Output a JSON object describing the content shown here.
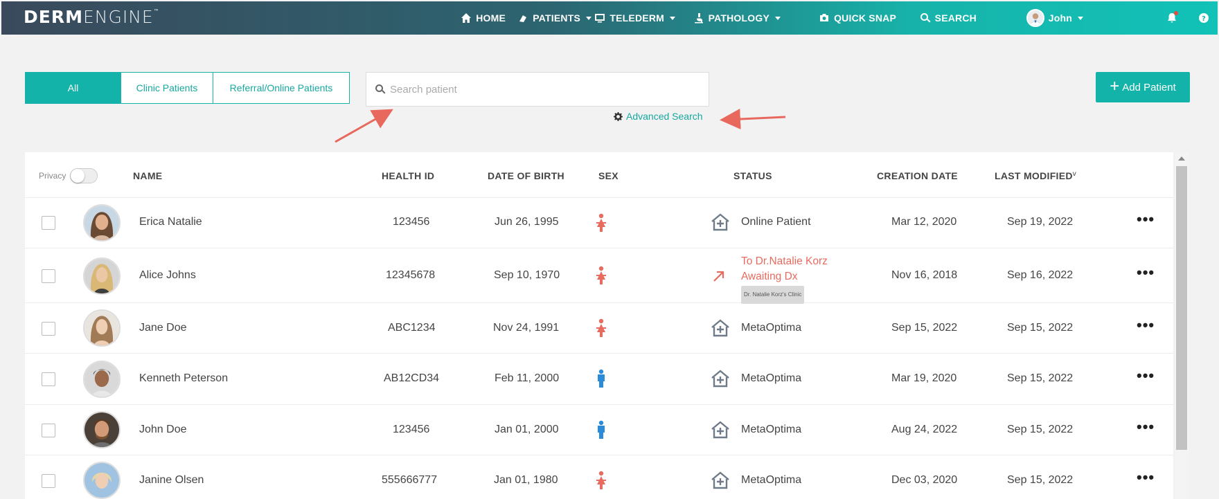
{
  "app": {
    "logo_bold": "DERM",
    "logo_light": "ENGINE",
    "logo_tm": "™"
  },
  "nav": {
    "home": "HOME",
    "patients": "PATIENTS",
    "telederm": "TELEDERM",
    "pathology": "PATHOLOGY",
    "quick_snap": "QUICK SNAP",
    "search": "SEARCH",
    "user": "John"
  },
  "filters": {
    "tabs": [
      {
        "label": "All",
        "active": true
      },
      {
        "label": "Clinic Patients",
        "active": false
      },
      {
        "label": "Referral/Online Patients",
        "active": false
      }
    ]
  },
  "search": {
    "placeholder": "Search patient",
    "advanced_label": "Advanced Search"
  },
  "actions": {
    "add_patient": "Add Patient"
  },
  "table": {
    "privacy_label": "Privacy",
    "columns": {
      "name": "NAME",
      "health_id": "HEALTH ID",
      "dob": "DATE OF BIRTH",
      "sex": "SEX",
      "status": "STATUS",
      "creation_date": "CREATION DATE",
      "last_modified": "LAST MODIFIED"
    },
    "rows": [
      {
        "name": "Erica Natalie",
        "health_id": "123456",
        "dob": "Jun 26, 1995",
        "sex": "female",
        "status": "Online Patient",
        "status_type": "clinic",
        "created": "Mar 12, 2020",
        "modified": "Sep 19, 2022"
      },
      {
        "name": "Alice Johns",
        "health_id": "12345678",
        "dob": "Sep 10, 1970",
        "sex": "female",
        "status_line1": "To Dr.Natalie Korz",
        "status_line2": "Awaiting Dx",
        "status_tag": "Dr. Natalie Korz's Clinic",
        "status_type": "referral",
        "created": "Nov 16, 2018",
        "modified": "Sep 16, 2022"
      },
      {
        "name": "Jane Doe",
        "health_id": "ABC1234",
        "dob": "Nov 24, 1991",
        "sex": "female",
        "status": "MetaOptima",
        "status_type": "clinic",
        "created": "Sep 15, 2022",
        "modified": "Sep 15, 2022"
      },
      {
        "name": "Kenneth Peterson",
        "health_id": "AB12CD34",
        "dob": "Feb 11, 2000",
        "sex": "male",
        "status": "MetaOptima",
        "status_type": "clinic",
        "created": "Mar 19, 2020",
        "modified": "Sep 15, 2022"
      },
      {
        "name": "John Doe",
        "health_id": "123456",
        "dob": "Jan 01, 2000",
        "sex": "male",
        "status": "MetaOptima",
        "status_type": "clinic",
        "created": "Aug 24, 2022",
        "modified": "Sep 15, 2022"
      },
      {
        "name": "Janine Olsen",
        "health_id": "555666777",
        "dob": "Jan 01, 1980",
        "sex": "female",
        "status": "MetaOptima",
        "status_type": "clinic",
        "created": "Dec 03, 2020",
        "modified": "Sep 15, 2022"
      }
    ]
  },
  "colors": {
    "accent": "#14b3a9",
    "female": "#e86b5f",
    "male": "#2a8bd8",
    "annotation_arrow": "#e8685d"
  }
}
